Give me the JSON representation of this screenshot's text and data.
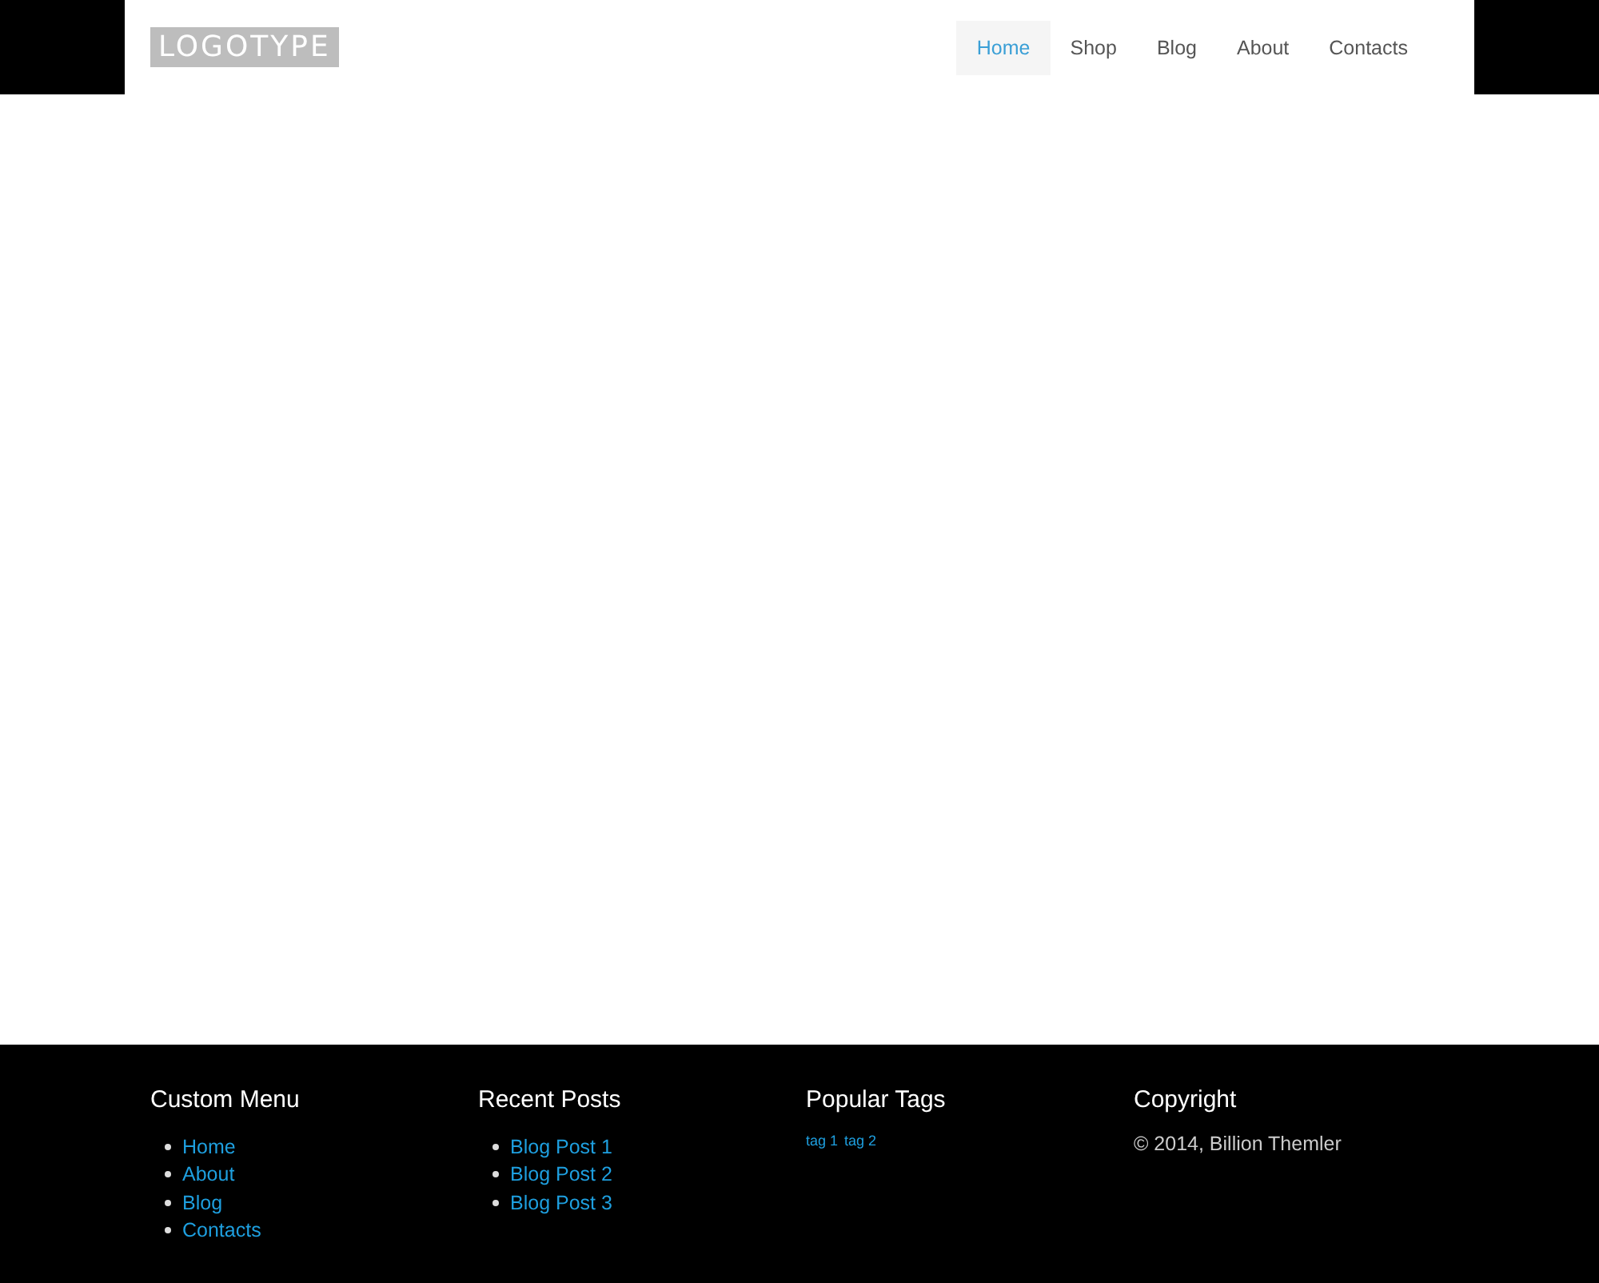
{
  "header": {
    "logo": "LOGOTYPE",
    "nav": [
      {
        "label": "Home",
        "selected": true
      },
      {
        "label": "Shop",
        "selected": false
      },
      {
        "label": "Blog",
        "selected": false
      },
      {
        "label": "About",
        "selected": false
      },
      {
        "label": "Contacts",
        "selected": false
      }
    ]
  },
  "footer": {
    "columns": [
      {
        "kind": "list",
        "title": "Custom Menu",
        "items": [
          "Home",
          "About",
          "Blog",
          "Contacts"
        ]
      },
      {
        "kind": "list",
        "title": "Recent Posts",
        "items": [
          "Blog Post 1",
          "Blog Post 2",
          "Blog Post 3"
        ]
      },
      {
        "kind": "tags",
        "title": "Popular Tags",
        "items": [
          "tag 1",
          "tag 2"
        ]
      },
      {
        "kind": "text",
        "title": "Copyright",
        "text": "© 2014, Billion Themler"
      }
    ]
  }
}
